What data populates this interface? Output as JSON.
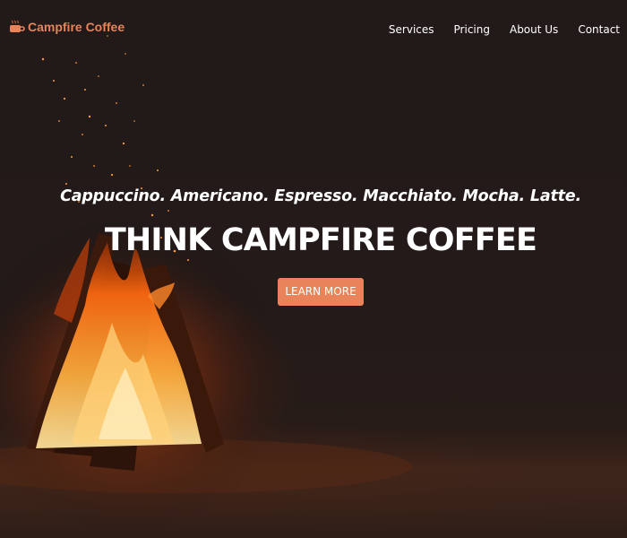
{
  "navbar": {
    "brand": {
      "name": "Campfire Coffee",
      "icon": "coffee-cup-icon"
    },
    "links": [
      {
        "label": "Services"
      },
      {
        "label": "Pricing"
      },
      {
        "label": "About Us"
      },
      {
        "label": "Contact"
      }
    ]
  },
  "hero": {
    "tagline": "Cappuccino. Americano. Espresso. Macchiato. Mocha. Latte.",
    "headline": "THINK CAMPFIRE COFFEE",
    "cta_label": "LEARN MORE",
    "background_image": "campfire-photo"
  },
  "colors": {
    "accent": "#e8835a",
    "background": "#221a19",
    "text": "#ffffff"
  }
}
